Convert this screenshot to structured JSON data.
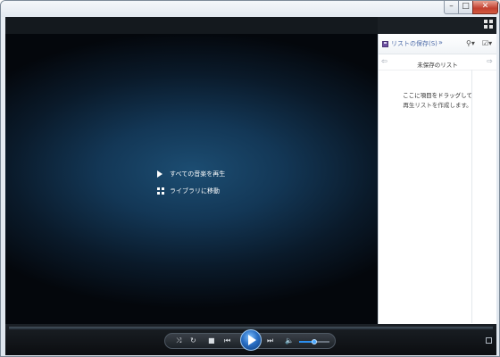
{
  "window": {
    "minimize_glyph": "–",
    "maximize_glyph": "□",
    "close_glyph": "✕"
  },
  "now_playing": {
    "play_all_label": "すべての音楽を再生",
    "go_to_library_label": "ライブラリに移動"
  },
  "list_pane": {
    "save_list_label": "リストの保存(S)",
    "more_glyph": "»",
    "list_options_glyph": "⚲▾",
    "clear_options_glyph": "☑▾",
    "back_glyph": "⇦",
    "forward_glyph": "⇨",
    "unsaved_list_title": "未保存のリスト",
    "drag_hint_line1": "ここに項目をドラッグして",
    "drag_hint_line2": "再生リストを作成します。"
  },
  "controls": {
    "shuffle_glyph": "⤨",
    "repeat_glyph": "↻",
    "stop_glyph": "■",
    "previous_glyph": "⏮",
    "next_glyph": "⏭",
    "mute_glyph": "🔈",
    "volume_level": 0.5
  },
  "icons": [
    "layout-switch-icon",
    "play-icon",
    "library-icon",
    "disk-icon",
    "resize-icon"
  ]
}
